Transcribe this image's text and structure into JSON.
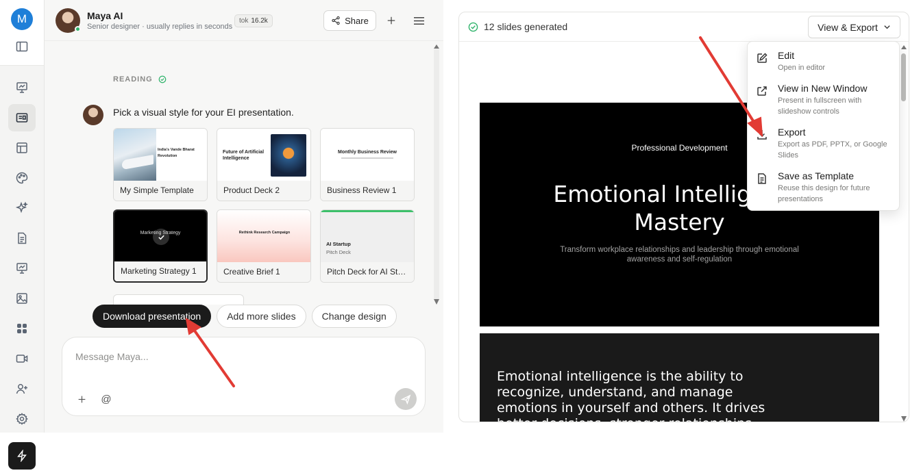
{
  "user": {
    "initial": "M"
  },
  "chat": {
    "name": "Maya AI",
    "subtitle": "Senior designer · usually replies in seconds",
    "tok_label": "tok",
    "tok_value": "16.2k",
    "share_label": "Share",
    "reading_label": "READING",
    "message": "Pick a visual style for your EI presentation.",
    "templates": [
      {
        "label": "My Simple Template",
        "thumb_title": "India's Vande Bharat Revolution"
      },
      {
        "label": "Product Deck 2",
        "thumb_title": "Future of Artificial Intelligence"
      },
      {
        "label": "Business Review 1",
        "thumb_title": "Monthly Business Review"
      },
      {
        "label": "Marketing Strategy 1",
        "thumb_title": "Marketing Strategy"
      },
      {
        "label": "Creative Brief 1",
        "thumb_title": "Rethink Research Campaign"
      },
      {
        "label": "Pitch Deck for AI Sta...",
        "thumb_title": "AI Startup",
        "thumb_sub": "Pitch Deck"
      }
    ],
    "chips": [
      "Download presentation",
      "Add more slides",
      "Change design"
    ],
    "composer_placeholder": "Message Maya..."
  },
  "panel": {
    "status": "12 slides generated",
    "view_export_label": "View & Export",
    "slide1": {
      "kicker": "Professional Development",
      "title": "Emotional Intelligence Mastery",
      "subtitle": "Transform workplace relationships and leadership through emotional awareness and self-regulation"
    },
    "slide2": {
      "text": "Emotional intelligence is the ability to recognize, understand, and manage emotions in yourself and others. It drives better decisions, stronger relationships"
    }
  },
  "menu": [
    {
      "title": "Edit",
      "desc": "Open in editor",
      "icon": "edit-icon"
    },
    {
      "title": "View in New Window",
      "desc": "Present in fullscreen with slideshow controls",
      "icon": "external-link-icon"
    },
    {
      "title": "Export",
      "desc": "Export as PDF, PPTX, or Google Slides",
      "icon": "download-icon"
    },
    {
      "title": "Save as Template",
      "desc": "Reuse this design for future presentations",
      "icon": "document-icon"
    }
  ],
  "colors": {
    "accent": "#1f7fd8",
    "dark": "#1b1b1b",
    "success": "#2fb36b",
    "annotation_arrow": "#e23b34"
  }
}
